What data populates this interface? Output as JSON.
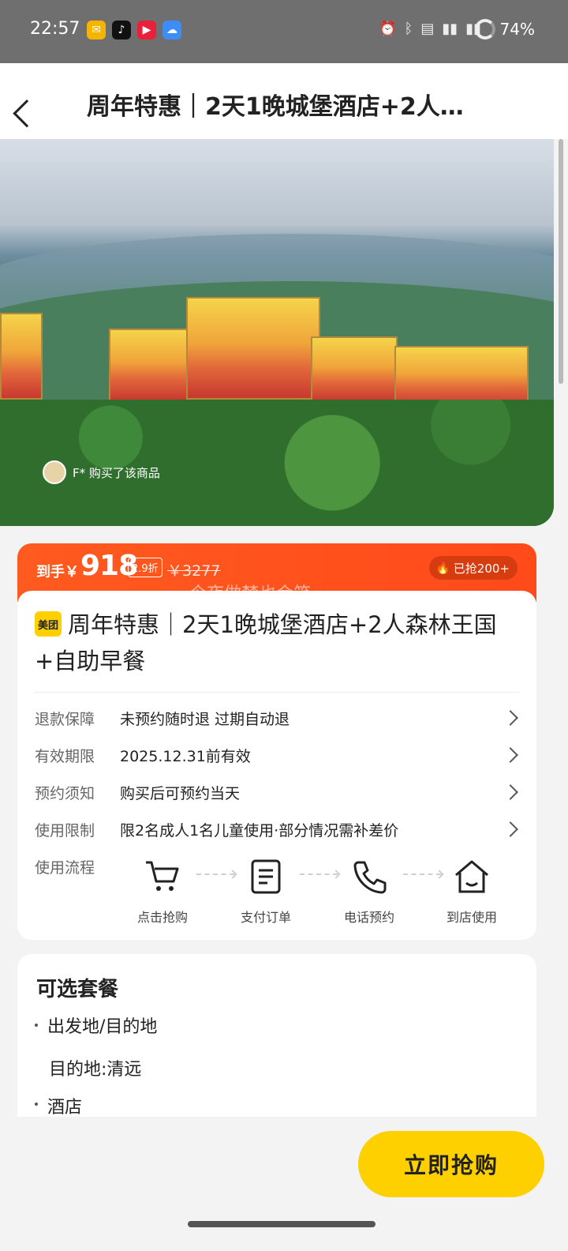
{
  "status_bar": {
    "time": "22:57",
    "battery": "74%",
    "app_icons": [
      "mail-icon",
      "tiktok-icon",
      "video-icon",
      "weather-icon"
    ],
    "system_icons": [
      "alarm-icon",
      "bluetooth-icon",
      "wifi-icon",
      "signal-icon",
      "signal-icon"
    ]
  },
  "header": {
    "title": "周年特惠｜2天1晚城堡酒店+2人森林王国+自助早餐"
  },
  "hero": {
    "buyer_text": "F* 购买了该商品"
  },
  "price": {
    "label": "到手￥",
    "amount": "918",
    "discount": "2.9折",
    "original": "￥3277",
    "grabbed": "已抢200+",
    "watermark": "今夜做梦也会笑"
  },
  "product": {
    "badge": "美团",
    "title": "周年特惠｜2天1晚城堡酒店+2人森林王国+自助早餐"
  },
  "details": [
    {
      "key": "退款保障",
      "value": "未预约随时退 过期自动退"
    },
    {
      "key": "有效期限",
      "value": "2025.12.31前有效"
    },
    {
      "key": "预约须知",
      "value": "购买后可预约当天"
    },
    {
      "key": "使用限制",
      "value": "限2名成人1名儿童使用·部分情况需补差价"
    }
  ],
  "flow": {
    "label": "使用流程",
    "steps": [
      "点击抢购",
      "支付订单",
      "电话预约",
      "到店使用"
    ]
  },
  "package": {
    "title": "可选套餐",
    "items": [
      "出发地/目的地",
      "目的地:清远",
      "酒店"
    ]
  },
  "footer": {
    "buy_button": "立即抢购"
  },
  "colors": {
    "accent_orange": "#ff5a1f",
    "brand_yellow": "#ffd000"
  }
}
